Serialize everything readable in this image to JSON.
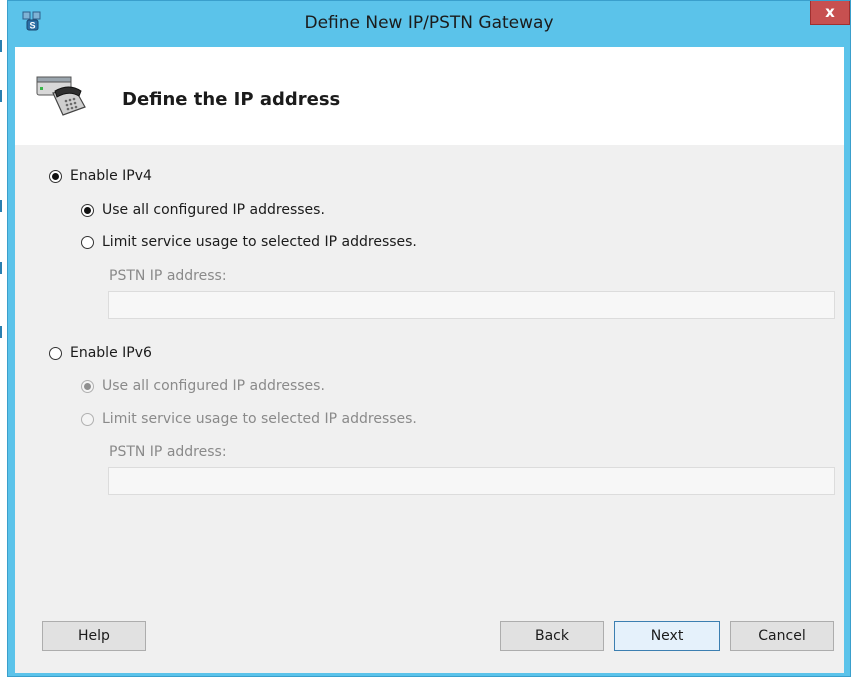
{
  "window": {
    "title": "Define New IP/PSTN Gateway",
    "close_label": "x"
  },
  "header": {
    "title": "Define the IP address"
  },
  "ipv4": {
    "enable_label": "Enable IPv4",
    "enabled": true,
    "use_all_label": "Use all configured IP addresses.",
    "use_all_selected": true,
    "limit_label": "Limit service usage to selected IP addresses.",
    "limit_selected": false,
    "pstn_label": "PSTN IP address:",
    "pstn_value": ""
  },
  "ipv6": {
    "enable_label": "Enable IPv6",
    "enabled": false,
    "use_all_label": "Use all configured IP addresses.",
    "use_all_selected": true,
    "limit_label": "Limit service usage to selected IP addresses.",
    "limit_selected": false,
    "pstn_label": "PSTN IP address:",
    "pstn_value": ""
  },
  "buttons": {
    "help": "Help",
    "back": "Back",
    "next": "Next",
    "cancel": "Cancel"
  },
  "colors": {
    "titlebar": "#5bc3ea",
    "close": "#c75050",
    "client": "#f0f0f0"
  }
}
